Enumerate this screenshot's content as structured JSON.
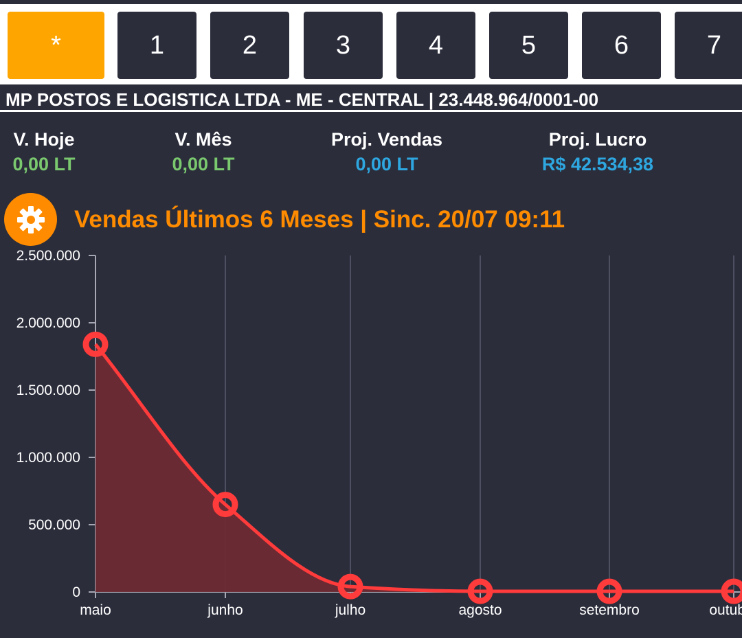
{
  "tabs": [
    {
      "label": "*",
      "active": true
    },
    {
      "label": "1"
    },
    {
      "label": "2"
    },
    {
      "label": "3"
    },
    {
      "label": "4"
    },
    {
      "label": "5"
    },
    {
      "label": "6"
    },
    {
      "label": "7"
    }
  ],
  "company": "MP POSTOS E LOGISTICA LTDA - ME - CENTRAL | 23.448.964/0001-00",
  "stats": [
    {
      "label": "V. Hoje",
      "value": "0,00 LT",
      "color": "#7bc96f"
    },
    {
      "label": "V. Mês",
      "value": "0,00 LT",
      "color": "#7bc96f"
    },
    {
      "label": "Proj. Vendas",
      "value": "0,00 LT",
      "color": "#2ea7e0"
    },
    {
      "label": "Proj. Lucro",
      "value": "R$ 42.534,38",
      "color": "#2ea7e0"
    }
  ],
  "settings_icon": "gear-icon",
  "chart_title": "Vendas Últimos 6 Meses | Sinc. 20/07 09:11",
  "colors": {
    "background": "#2b2d3b",
    "accent": "#ffa500",
    "title": "#ff8c00",
    "series_line": "#ff3b3b",
    "series_fill": "#6e2a33"
  },
  "chart_data": {
    "type": "area",
    "categories": [
      "maio",
      "junho",
      "julho",
      "agosto",
      "setembro",
      "outubro"
    ],
    "series": [
      {
        "values": [
          1840000,
          650000,
          40000,
          5000,
          5000,
          5000
        ]
      }
    ],
    "ylim": [
      0,
      2500000
    ],
    "yticks": [
      "0",
      "500.000",
      "1.000.000",
      "1.500.000",
      "2.000.000",
      "2.500.000"
    ],
    "ytick_values": [
      0,
      500000,
      1000000,
      1500000,
      2000000,
      2500000
    ],
    "grid": "vertical"
  }
}
